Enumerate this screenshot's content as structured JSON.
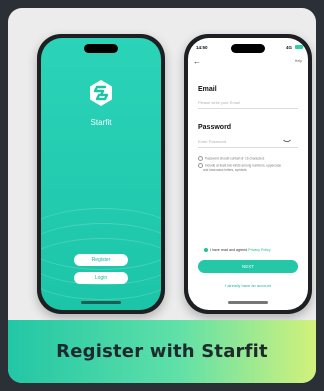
{
  "left_phone": {
    "app_name": "Starfit",
    "register_label": "Register",
    "login_label": "Login"
  },
  "right_phone": {
    "time": "14:50",
    "signal": "4G",
    "help_label": "Help",
    "email_label": "Email",
    "email_placeholder": "Please write your Email",
    "password_label": "Password",
    "password_placeholder": "Enter Password",
    "rule_1": "Password should contain 8- 16 characters",
    "rule_2": "Include at least two kinds among numbers, uppercase and lowercase letters, symbols",
    "agree_text": "I have read and agreed",
    "privacy_link": "Privacy Policy",
    "next_label": "NEXT",
    "have_account": "I already have an account"
  },
  "banner": {
    "title": "Register with Starfit"
  },
  "colors": {
    "accent": "#24c7a7",
    "background": "#ececec",
    "outer": "#2b3037"
  }
}
